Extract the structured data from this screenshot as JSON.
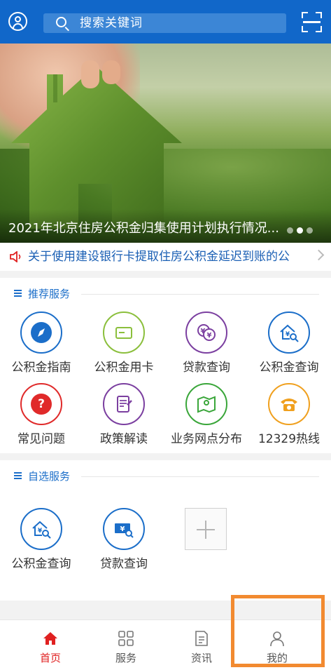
{
  "header": {
    "search_placeholder": "搜索关键词"
  },
  "banner": {
    "caption": "2021年北京住房公积金归集使用计划执行情况..."
  },
  "notice": {
    "text": "关于使用建设银行卡提取住房公积金延迟到账的公"
  },
  "recommended": {
    "title": "推荐服务",
    "items": [
      {
        "label": "公积金指南",
        "icon": "compass-icon",
        "color": "#1b6ec9"
      },
      {
        "label": "公积金用卡",
        "icon": "card-icon",
        "color": "#8bbf3c"
      },
      {
        "label": "贷款查询",
        "icon": "coins-icon",
        "color": "#7b3fa0"
      },
      {
        "label": "公积金查询",
        "icon": "house-search-icon",
        "color": "#1b6ec9"
      },
      {
        "label": "常见问题",
        "icon": "question-icon",
        "color": "#e02a2a"
      },
      {
        "label": "政策解读",
        "icon": "document-icon",
        "color": "#7b3fa0"
      },
      {
        "label": "业务网点分布",
        "icon": "map-icon",
        "color": "#3aa63a"
      },
      {
        "label": "12329热线",
        "icon": "phone-icon",
        "color": "#f0a01e"
      }
    ]
  },
  "custom": {
    "title": "自选服务",
    "items": [
      {
        "label": "公积金查询",
        "icon": "house-search-icon",
        "color": "#1b6ec9"
      },
      {
        "label": "贷款查询",
        "icon": "money-search-icon",
        "color": "#1b6ec9"
      }
    ]
  },
  "nav": {
    "items": [
      {
        "label": "首页",
        "icon": "home-icon",
        "active": true
      },
      {
        "label": "服务",
        "icon": "grid-icon",
        "active": false
      },
      {
        "label": "资讯",
        "icon": "news-icon",
        "active": false
      },
      {
        "label": "我的",
        "icon": "profile-icon",
        "active": false
      }
    ]
  },
  "colors": {
    "brand": "#1167c9",
    "active_nav": "#e02020",
    "highlight": "#f28a30"
  }
}
